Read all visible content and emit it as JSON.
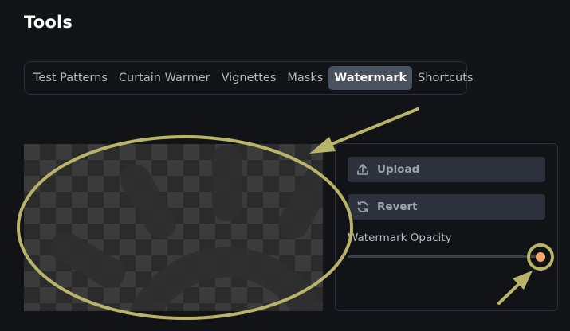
{
  "page": {
    "title": "Tools"
  },
  "tabs": [
    {
      "label": "Test Patterns",
      "active": false
    },
    {
      "label": "Curtain Warmer",
      "active": false
    },
    {
      "label": "Vignettes",
      "active": false
    },
    {
      "label": "Masks",
      "active": false
    },
    {
      "label": "Watermark",
      "active": true
    },
    {
      "label": "Shortcuts",
      "active": false
    }
  ],
  "watermark_panel": {
    "upload_label": "Upload",
    "upload_icon": "upload-icon",
    "revert_label": "Revert",
    "revert_icon": "revert-icon",
    "opacity_label": "Watermark Opacity",
    "opacity_value": 1.0
  },
  "colors": {
    "accent": "#f0a868",
    "active_tab": "#4a5260",
    "annotation": "#b8b46a"
  }
}
